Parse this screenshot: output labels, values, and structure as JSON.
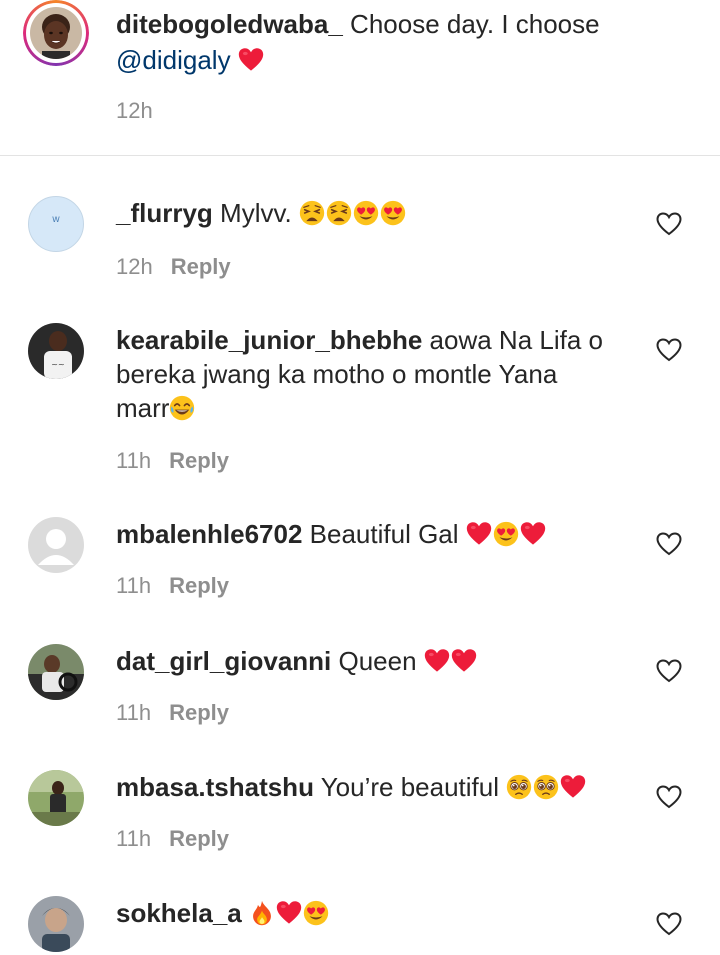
{
  "caption": {
    "username": "ditebogoledwaba_",
    "text": " Choose day. I choose ",
    "mention": "@didigaly",
    "time": "12h"
  },
  "comments": [
    {
      "username": "_flurryg",
      "text": " Mylvv. ",
      "time": "12h",
      "reply": "Reply",
      "avatar_label": "w"
    },
    {
      "username": "kearabile_junior_bhebhe",
      "text": " aowa Na Lifa o bereka jwang ka motho o montle Yana marr",
      "time": "11h",
      "reply": "Reply"
    },
    {
      "username": "mbalenhle6702",
      "text": " Beautiful Gal ",
      "time": "11h",
      "reply": "Reply"
    },
    {
      "username": "dat_girl_giovanni",
      "text": " Queen ",
      "time": "11h",
      "reply": "Reply"
    },
    {
      "username": "mbasa.tshatshu",
      "text": " You’re beautiful ",
      "time": "11h",
      "reply": "Reply"
    },
    {
      "username": "sokhela_a",
      "text": " ",
      "time": "",
      "reply": ""
    }
  ],
  "colors": {
    "username": "#262626",
    "mention": "#00376b",
    "muted": "#8e8e8e",
    "heart_red": "#ed1c3a",
    "divider": "#e3e3e3"
  },
  "icons": {
    "like": "heart-outline-icon",
    "emoji_heart": "red-heart",
    "emoji_weary": "weary-face",
    "emoji_heart_eyes": "heart-eyes-face",
    "emoji_joy": "tears-of-joy-face",
    "emoji_pleading": "pleading-face",
    "emoji_fire": "fire"
  }
}
